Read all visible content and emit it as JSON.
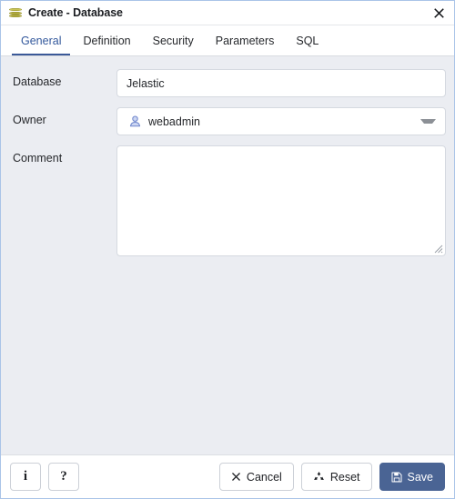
{
  "window": {
    "title": "Create - Database",
    "icon": "database-icon",
    "close_label": "✖"
  },
  "tabs": [
    {
      "label": "General",
      "active": true
    },
    {
      "label": "Definition",
      "active": false
    },
    {
      "label": "Security",
      "active": false
    },
    {
      "label": "Parameters",
      "active": false
    },
    {
      "label": "SQL",
      "active": false
    }
  ],
  "form": {
    "database": {
      "label": "Database",
      "value": "Jelastic",
      "placeholder": ""
    },
    "owner": {
      "label": "Owner",
      "value": "webadmin",
      "icon": "user-icon"
    },
    "comment": {
      "label": "Comment",
      "value": "",
      "placeholder": ""
    }
  },
  "footer": {
    "info_label": "i",
    "help_label": "?",
    "cancel_label": "Cancel",
    "reset_label": "Reset",
    "save_label": "Save"
  },
  "colors": {
    "accent": "#3b5998",
    "primary_button": "#4a6494",
    "body_background": "#ebedf2",
    "db_icon": "#b3ad3f",
    "user_icon": "#7a8fd0"
  }
}
